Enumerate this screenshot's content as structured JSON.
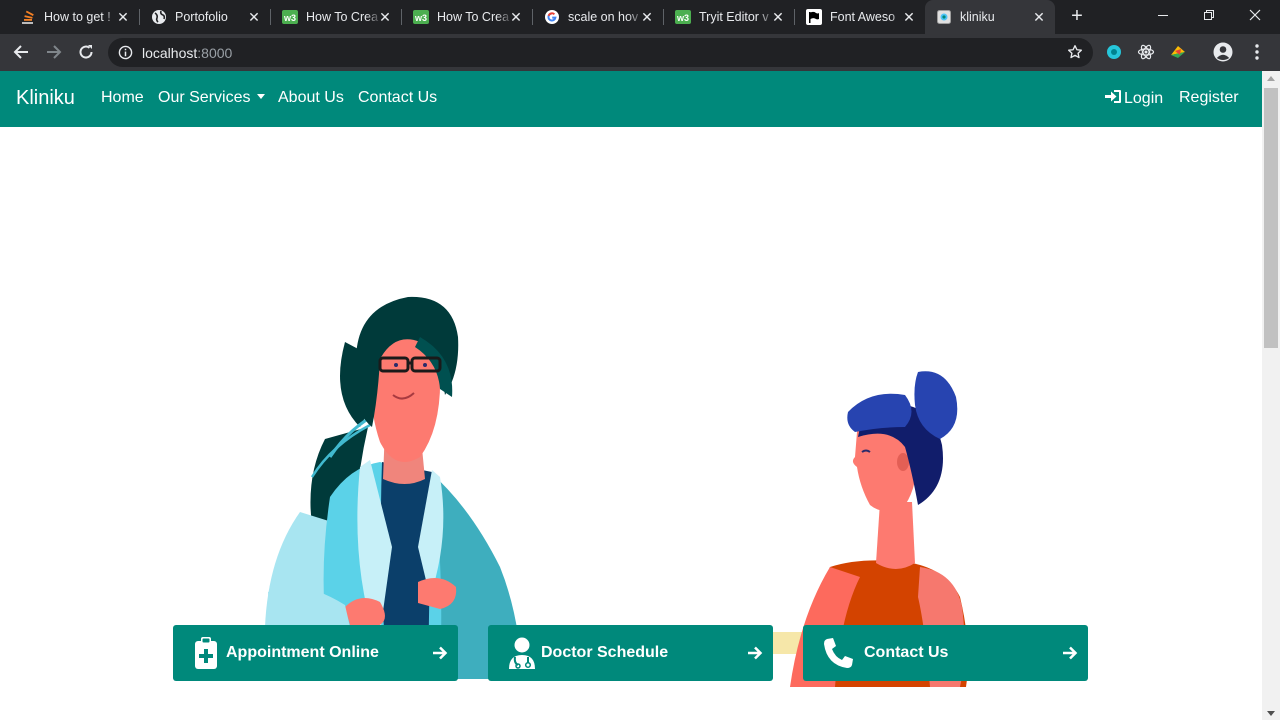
{
  "browser": {
    "tabs": [
      {
        "title": "How to get !",
        "icon": "stackoverflow-icon"
      },
      {
        "title": "Portofolio",
        "icon": "globe-icon"
      },
      {
        "title": "How To Crea",
        "icon": "w3schools-icon"
      },
      {
        "title": "How To Crea",
        "icon": "w3schools-icon"
      },
      {
        "title": "scale on hov",
        "icon": "google-icon"
      },
      {
        "title": "Tryit Editor v",
        "icon": "w3schools-icon"
      },
      {
        "title": "Font Aweso",
        "icon": "fontawesome-flag-icon"
      },
      {
        "title": "kliniku",
        "icon": "page-icon",
        "active": true
      }
    ],
    "url_host": "localhost",
    "url_port": ":8000"
  },
  "navbar": {
    "brand": "Kliniku",
    "links": [
      "Home",
      "Our Services",
      "About Us",
      "Contact Us"
    ],
    "login": "Login",
    "register": "Register",
    "color": "#00897b"
  },
  "cards": [
    {
      "label": "Appointment Online",
      "icon": "clipboard-plus-icon"
    },
    {
      "label": "Doctor Schedule",
      "icon": "user-doctor-icon"
    },
    {
      "label": "Contact Us",
      "icon": "phone-icon"
    }
  ]
}
